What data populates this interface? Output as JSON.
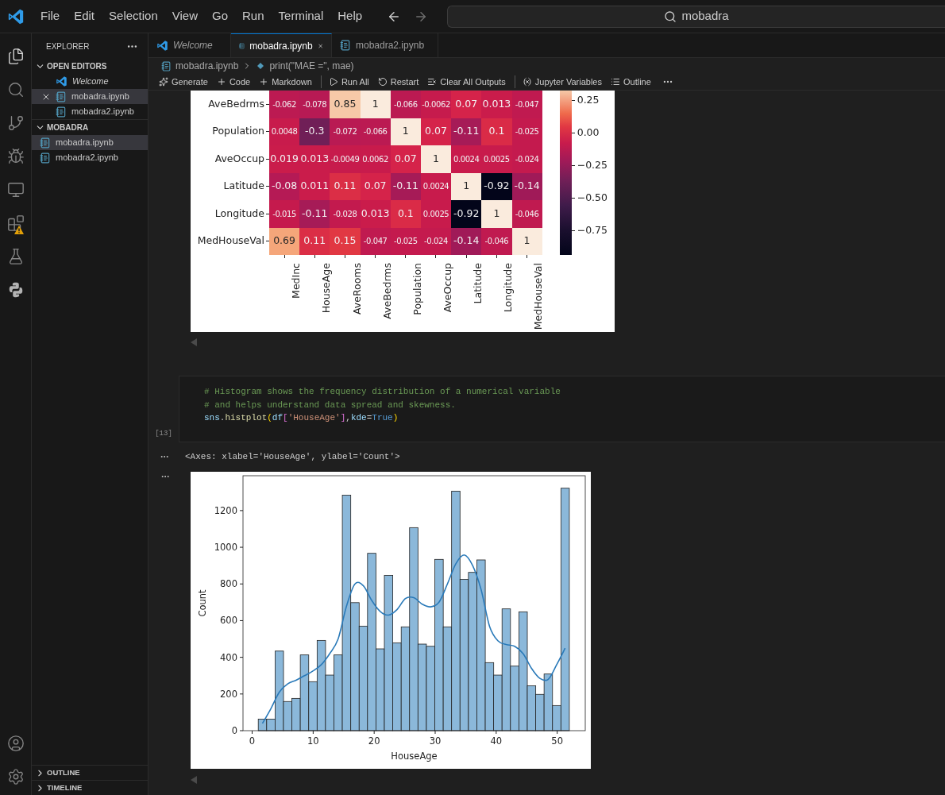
{
  "menu": [
    "File",
    "Edit",
    "Selection",
    "View",
    "Go",
    "Run",
    "Terminal",
    "Help"
  ],
  "search": {
    "value": "mobadra"
  },
  "sidebar": {
    "title": "EXPLORER",
    "sections": [
      {
        "label": "OPEN EDITORS",
        "expanded": true,
        "items": [
          {
            "label": "Welcome",
            "kind": "welcome",
            "selected": false,
            "closable": false
          },
          {
            "label": "mobadra.ipynb",
            "kind": "notebook",
            "selected": true,
            "closable": true
          },
          {
            "label": "mobadra2.ipynb",
            "kind": "notebook",
            "selected": false,
            "closable": false
          }
        ]
      },
      {
        "label": "MOBADRA",
        "expanded": true,
        "items": [
          {
            "label": "mobadra.ipynb",
            "kind": "notebook",
            "selected": true
          },
          {
            "label": "mobadra2.ipynb",
            "kind": "notebook",
            "selected": false
          }
        ]
      }
    ],
    "bottom": [
      {
        "label": "OUTLINE",
        "expanded": false
      },
      {
        "label": "TIMELINE",
        "expanded": false
      }
    ]
  },
  "tabs": [
    {
      "label": "Welcome",
      "kind": "welcome",
      "selected": false
    },
    {
      "label": "mobadra.ipynb",
      "kind": "notebook",
      "selected": true
    },
    {
      "label": "mobadra2.ipynb",
      "kind": "notebook",
      "selected": false
    }
  ],
  "breadcrumb": [
    "mobadra.ipynb",
    "print(\"MAE =\", mae)"
  ],
  "toolbar": [
    {
      "label": "Generate",
      "kind": "sparkle"
    },
    {
      "label": "Code",
      "kind": "plus"
    },
    {
      "label": "Markdown",
      "kind": "plus"
    },
    {
      "label": "Run All",
      "kind": "run",
      "divider": true
    },
    {
      "label": "Restart",
      "kind": "restart"
    },
    {
      "label": "Clear All Outputs",
      "kind": "clear"
    },
    {
      "label": "Jupyter Variables",
      "kind": "variables",
      "divider": true
    },
    {
      "label": "Outline",
      "kind": "outline"
    }
  ],
  "heatmap": {
    "rows": [
      {
        "label": "AveBedrms",
        "cells": [
          {
            "value": "-0.062",
            "color": "#bc1a52"
          },
          {
            "value": "-0.078",
            "color": "#b71a54"
          },
          {
            "value": "0.85",
            "color": "#f6c9a8"
          },
          {
            "value": "1",
            "color": "#faebdd"
          },
          {
            "value": "-0.066",
            "color": "#bb1a52"
          },
          {
            "value": "-0.0062",
            "color": "#c61b4d"
          },
          {
            "value": "0.07",
            "color": "#d5234a"
          },
          {
            "value": "0.013",
            "color": "#ca1c4b"
          },
          {
            "value": "-0.047",
            "color": "#c01a50"
          }
        ]
      },
      {
        "label": "Population",
        "cells": [
          {
            "value": "0.0048",
            "color": "#c81b4c"
          },
          {
            "value": "-0.3",
            "color": "#701f57"
          },
          {
            "value": "-0.072",
            "color": "#b91a53"
          },
          {
            "value": "-0.066",
            "color": "#bb1a52"
          },
          {
            "value": "1",
            "color": "#faebdd"
          },
          {
            "value": "0.07",
            "color": "#d5234a"
          },
          {
            "value": "-0.11",
            "color": "#a61b57"
          },
          {
            "value": "0.1",
            "color": "#da2b47"
          },
          {
            "value": "-0.025",
            "color": "#c41a4e"
          }
        ]
      },
      {
        "label": "AveOccup",
        "cells": [
          {
            "value": "0.019",
            "color": "#ca1c4b"
          },
          {
            "value": "0.013",
            "color": "#ca1c4b"
          },
          {
            "value": "-0.0049",
            "color": "#c71b4c"
          },
          {
            "value": "0.0062",
            "color": "#c81b4c"
          },
          {
            "value": "0.07",
            "color": "#d5234a"
          },
          {
            "value": "1",
            "color": "#faebdd"
          },
          {
            "value": "0.0024",
            "color": "#c81b4c"
          },
          {
            "value": "0.0025",
            "color": "#c81b4c"
          },
          {
            "value": "-0.024",
            "color": "#c41a4e"
          }
        ]
      },
      {
        "label": "Latitude",
        "cells": [
          {
            "value": "-0.08",
            "color": "#b51a55"
          },
          {
            "value": "0.011",
            "color": "#ca1c4b"
          },
          {
            "value": "0.11",
            "color": "#db2e46"
          },
          {
            "value": "0.07",
            "color": "#d5234a"
          },
          {
            "value": "-0.11",
            "color": "#a61b57"
          },
          {
            "value": "0.0024",
            "color": "#c81b4c"
          },
          {
            "value": "1",
            "color": "#faebdd"
          },
          {
            "value": "-0.92",
            "color": "#03051a"
          },
          {
            "value": "-0.14",
            "color": "#a01a58"
          }
        ]
      },
      {
        "label": "Longitude",
        "cells": [
          {
            "value": "-0.015",
            "color": "#c51a4d"
          },
          {
            "value": "-0.11",
            "color": "#a61b57"
          },
          {
            "value": "-0.028",
            "color": "#c31a4e"
          },
          {
            "value": "0.013",
            "color": "#ca1c4b"
          },
          {
            "value": "0.1",
            "color": "#da2b47"
          },
          {
            "value": "0.0025",
            "color": "#c81b4c"
          },
          {
            "value": "-0.92",
            "color": "#03051a"
          },
          {
            "value": "1",
            "color": "#faebdd"
          },
          {
            "value": "-0.046",
            "color": "#c01a50"
          }
        ]
      },
      {
        "label": "MedHouseVal",
        "cells": [
          {
            "value": "0.69",
            "color": "#f5a67a"
          },
          {
            "value": "0.11",
            "color": "#db2e46"
          },
          {
            "value": "0.15",
            "color": "#e13843"
          },
          {
            "value": "-0.047",
            "color": "#c01a50"
          },
          {
            "value": "-0.025",
            "color": "#c41a4e"
          },
          {
            "value": "-0.024",
            "color": "#c41a4e"
          },
          {
            "value": "-0.14",
            "color": "#a01a58"
          },
          {
            "value": "-0.046",
            "color": "#c01a50"
          },
          {
            "value": "1",
            "color": "#faebdd"
          }
        ]
      }
    ],
    "bottom_labels": [
      "MedInc",
      "HouseAge",
      "AveRooms",
      "AveBedrms",
      "Population",
      "AveOccup",
      "Latitude",
      "Longitude",
      "MedHouseVal"
    ],
    "colorbar_ticks": [
      "0.25",
      "0.00",
      "−0.25",
      "−0.50",
      "−0.75"
    ]
  },
  "code_cell": {
    "execution": "[13]",
    "lines": [
      [
        {
          "kind": "comment",
          "text": "# Histogram shows the frequency distribution of a numerical variable"
        }
      ],
      [
        {
          "kind": "comment",
          "text": "# and helps understand data spread and skewness."
        }
      ],
      [
        {
          "kind": "variable",
          "text": "sns"
        },
        {
          "kind": "punct",
          "text": "."
        },
        {
          "kind": "function",
          "text": "histplot"
        },
        {
          "kind": "bracket",
          "text": "("
        },
        {
          "kind": "variable",
          "text": "df"
        },
        {
          "kind": "bracket2",
          "text": "["
        },
        {
          "kind": "string",
          "text": "'HouseAge'"
        },
        {
          "kind": "bracket2",
          "text": "]"
        },
        {
          "kind": "punct",
          "text": ","
        },
        {
          "kind": "variable",
          "text": "kde"
        },
        {
          "kind": "punct",
          "text": "="
        },
        {
          "kind": "keyword",
          "text": "True"
        },
        {
          "kind": "bracket",
          "text": ")"
        }
      ]
    ]
  },
  "output_text": "<Axes: xlabel='HouseAge', ylabel='Count'>",
  "histogram": {
    "chart_data": {
      "type": "bar",
      "xlabel": "HouseAge",
      "ylabel": "Count",
      "x": [
        1.69,
        3.07,
        4.45,
        5.82,
        7.2,
        8.58,
        9.96,
        11.34,
        12.71,
        14.09,
        15.47,
        16.85,
        18.23,
        19.6,
        20.98,
        22.36,
        23.74,
        25.12,
        26.49,
        27.87,
        29.25,
        30.63,
        32.01,
        33.38,
        34.76,
        36.14,
        37.52,
        38.9,
        40.27,
        41.65,
        43.03,
        44.41,
        45.79,
        47.16,
        48.54,
        49.92,
        51.3
      ],
      "series": [
        {
          "type": "bar",
          "color": "#8bb8da",
          "values": [
            63,
            63,
            434,
            159,
            176,
            413,
            267,
            492,
            303,
            413,
            1284,
            698,
            570,
            967,
            446,
            847,
            479,
            566,
            1107,
            472,
            460,
            934,
            566,
            1306,
            825,
            863,
            931,
            371,
            303,
            664,
            352,
            648,
            245,
            198,
            309,
            137,
            1322
          ]
        },
        {
          "type": "line",
          "color": "#2a7ab9",
          "values": [
            40,
            120,
            210,
            255,
            275,
            300,
            325,
            360,
            420,
            500,
            680,
            800,
            790,
            710,
            650,
            630,
            660,
            720,
            725,
            690,
            675,
            700,
            800,
            910,
            958,
            900,
            770,
            570,
            490,
            470,
            460,
            420,
            340,
            285,
            280,
            360,
            450
          ]
        }
      ],
      "xlim": [
        -1.5,
        54.6
      ],
      "ylim": [
        0,
        1390
      ],
      "xticks": [
        0,
        10,
        20,
        30,
        40,
        50
      ],
      "yticks": [
        0,
        200,
        400,
        600,
        800,
        1000,
        1200
      ]
    }
  }
}
